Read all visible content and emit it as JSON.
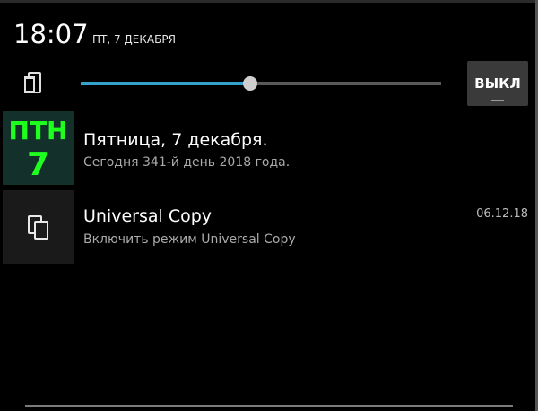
{
  "status": {
    "time": "18:07",
    "date": "ПТ, 7 ДЕКАБРЯ"
  },
  "brightness": {
    "icon": "brightness-phone-icon",
    "level": 0.47,
    "toggle_label": "ВЫКЛ"
  },
  "notifications": [
    {
      "app": "calendar",
      "tile_day": "ПТН",
      "tile_number": "7",
      "title": "Пятница, 7 декабря.",
      "subtitle": "Сегодня 341-й день 2018 года."
    },
    {
      "app": "universal-copy",
      "icon": "copy-icon",
      "title": "Universal Copy",
      "subtitle": "Включить режим Universal Copy",
      "time": "06.12.18"
    }
  ],
  "colors": {
    "background": "#000000",
    "accent": "#33a3cc",
    "calendar_text": "#1fff1f",
    "calendar_tile": "#14302a"
  }
}
